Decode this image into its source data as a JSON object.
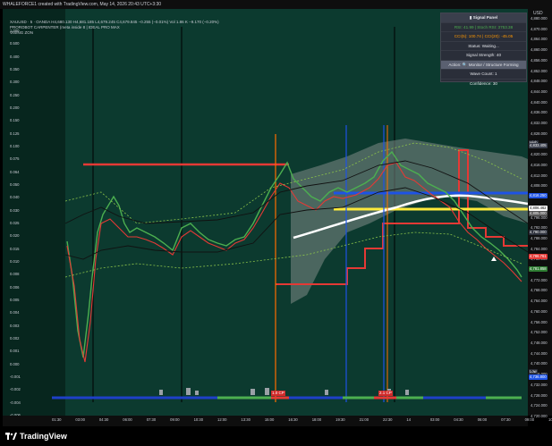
{
  "header": {
    "creator_line": "WHALEFORCE1 created with TradingView.com, May 14, 2026 20:43 UTC+3:30",
    "currency": "USD"
  },
  "legend": {
    "symbol_line": "XAUUSD · 5 · OANDA  H4,680.130  H4,681.185  L4,679.245  C4,679.845  −0.255 (−0.01%)  Vol 1.86 K  −9.170 (−0.20%)",
    "indicator1": "PROROBOT CARPENTER (meta inside 8 | IDEAL PRO MAX",
    "indicator2": "VISING ZON"
  },
  "left_axis": {
    "labels": [
      "1.000",
      "0.500",
      "0.400",
      "0.350",
      "0.300",
      "0.250",
      "0.200",
      "0.150",
      "0.125",
      "0.100",
      "0.075",
      "0.064",
      "0.050",
      "0.040",
      "0.030",
      "0.025",
      "0.020",
      "0.015",
      "0.010",
      "0.008",
      "0.006",
      "0.005",
      "0.004",
      "0.003",
      "0.002",
      "0.001",
      "0.000",
      "-0.001",
      "-0.002",
      "-0.004",
      "-0.006"
    ]
  },
  "right_axis": {
    "labels": [
      "4,880.000",
      "4,870.000",
      "4,864.000",
      "4,860.000",
      "4,856.000",
      "4,852.000",
      "4,848.000",
      "4,844.000",
      "4,840.000",
      "4,836.000",
      "4,832.000",
      "4,828.000",
      "4,824.000",
      "4,820.000",
      "4,816.000",
      "4,812.000",
      "4,808.000",
      "4,804.000",
      "4,800.000",
      "4,796.000",
      "4,792.000",
      "4,788.000",
      "4,784.000",
      "4,780.000",
      "4,776.000",
      "4,772.000",
      "4,768.000",
      "4,764.000",
      "4,760.000",
      "4,756.000",
      "4,752.000",
      "4,748.000",
      "4,744.000",
      "4,740.000",
      "4,736.000",
      "4,732.000",
      "4,728.000",
      "4,724.000",
      "4,720.000"
    ],
    "tags": [
      {
        "text": "High",
        "color": "#2a2e39"
      },
      {
        "text": "4,833.405",
        "color": "#3a3f4c"
      },
      {
        "text": "4,816.250",
        "color": "#1e53e5"
      },
      {
        "text": "4,806.462",
        "color": "#ffffff"
      },
      {
        "text": "4,805.000",
        "color": "#555"
      },
      {
        "text": "4,790.000",
        "color": "#2a2e39"
      },
      {
        "text": "4,786.761",
        "color": "#e53935"
      },
      {
        "text": "4,781.858",
        "color": "#2e7d32"
      },
      {
        "text": "Low",
        "color": "#2a2e39"
      },
      {
        "text": "4,736.800",
        "color": "#1e53e5"
      }
    ]
  },
  "x_axis": {
    "labels": [
      "01:30",
      "03:00",
      "04:30",
      "06:00",
      "07:30",
      "09:00",
      "10:30",
      "12:00",
      "13:30",
      "15:00",
      "16:30",
      "18:00",
      "19:30",
      "21:00",
      "22:30",
      "14",
      "03:00",
      "04:30",
      "06:00",
      "07:30",
      "09:00",
      "10:30"
    ]
  },
  "signal_panel": {
    "title": "Signal Panel",
    "rsi_stoch": "RSI: 41.99 | Stoch RSI: 3753.38",
    "cci_coi": "CCI(5): 100.74 | CCI(20): -45.05",
    "status": "Status: Waiting...",
    "strength": "Signal Strength: 40",
    "action": "Action: 🔍 Monitor / Structure Forming",
    "wave_count": "Wave Count: 1",
    "confidence": "Confidence: 30"
  },
  "flags": {
    "flag1": "1.0 CP",
    "flag2": "2.1 CP"
  },
  "footer": {
    "brand": "TradingView"
  },
  "colors": {
    "background_green": "#0c3a2f",
    "red_line": "#e53935",
    "blue_line": "#1e53e5",
    "yellow_line": "#ffeb3b",
    "white_line": "#ffffff",
    "orange_line": "#ff6d00"
  }
}
